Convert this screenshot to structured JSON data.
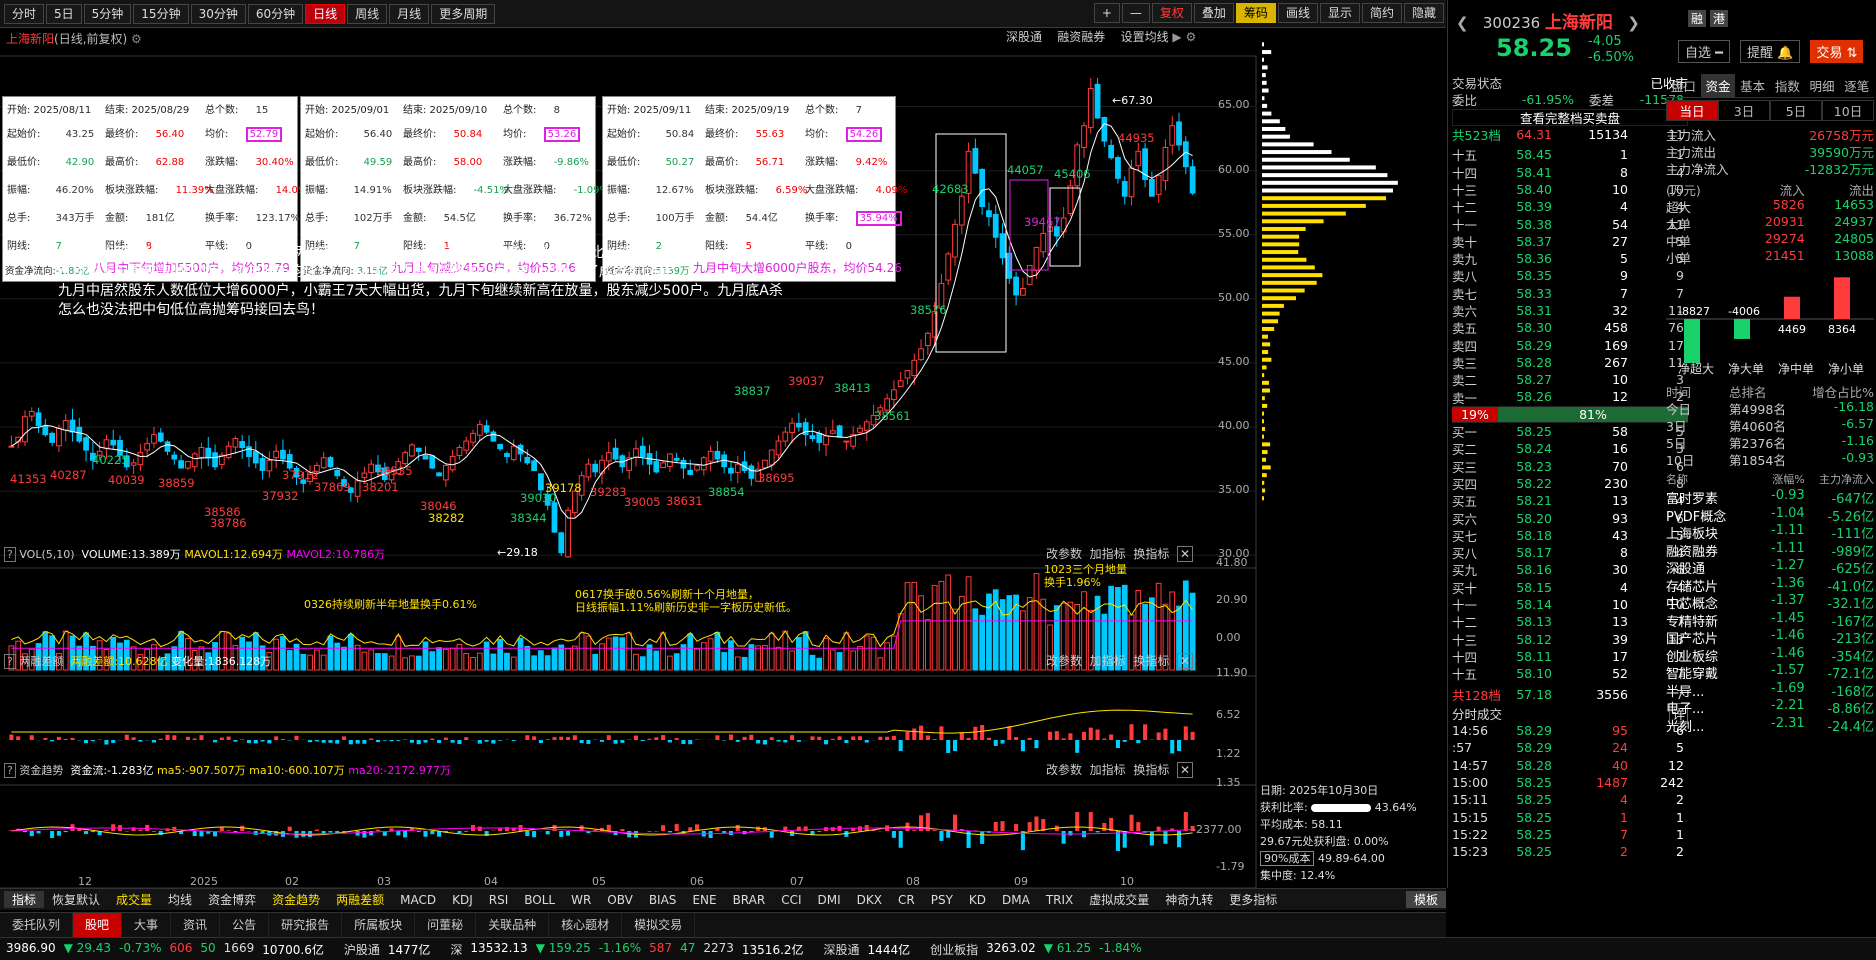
{
  "toolbar": {
    "periods": [
      "分时",
      "5日",
      "5分钟",
      "15分钟",
      "30分钟",
      "60分钟",
      "日线",
      "周线",
      "月线",
      "更多周期"
    ],
    "active": "日线",
    "right": [
      "+",
      "—",
      "复权",
      "叠加",
      "筹码",
      "画线",
      "显示",
      "简约",
      "隐藏"
    ]
  },
  "title": {
    "name": "上海新阳",
    "sub": "(日线,前复权)",
    "right": [
      "深股通",
      "融资融券",
      "设置均线"
    ]
  },
  "boxes": [
    {
      "start": "开始: 2025/08/11",
      "end": "结束: 2025/08/29",
      "count_label": "总个数:",
      "count": "15",
      "open_label": "起始价:",
      "open": "43.25",
      "close_label": "最终价:",
      "close": "56.40",
      "avg_label": "均价:",
      "avg": "52.79",
      "low_label": "最低价:",
      "low": "42.90",
      "high_label": "最高价:",
      "high": "62.88",
      "chg_label": "涨跌幅:",
      "chg": "30.40%",
      "amp_label": "振幅:",
      "amp": "46.20%",
      "sect_label": "板块涨跌幅:",
      "sect": "11.39%",
      "mkt_label": "大盘涨跌幅:",
      "mkt": "14.09%",
      "vol_label": "总手:",
      "vol": "343万手",
      "amt_label": "金额:",
      "amt": "181亿",
      "turn_label": "换手率:",
      "turn": "123.17%",
      "neg_label": "阴线:",
      "neg": "7",
      "pos_label": "阳线:",
      "pos": "8",
      "flat_label": "平线:",
      "flat": "0",
      "flow_label": "资金净流向:",
      "flow": "-1.80亿",
      "note": "八月中下旬增加5500户，均价52.79"
    },
    {
      "start": "开始: 2025/09/01",
      "end": "结束: 2025/09/10",
      "count_label": "总个数:",
      "count": "8",
      "open_label": "起始价:",
      "open": "56.40",
      "close_label": "最终价:",
      "close": "50.84",
      "avg_label": "均价:",
      "avg": "53.26",
      "low_label": "最低价:",
      "low": "49.59",
      "high_label": "最高价:",
      "high": "58.00",
      "chg_label": "涨跌幅:",
      "chg": "-9.86%",
      "amp_label": "振幅:",
      "amp": "14.91%",
      "sect_label": "板块涨跌幅:",
      "sect": "-4.51%",
      "mkt_label": "大盘涨跌幅:",
      "mkt": "-1.09%",
      "vol_label": "总手:",
      "vol": "102万手",
      "amt_label": "金额:",
      "amt": "54.5亿",
      "turn_label": "换手率:",
      "turn": "36.72%",
      "neg_label": "阴线:",
      "neg": "7",
      "pos_label": "阳线:",
      "pos": "1",
      "flat_label": "平线:",
      "flat": "0",
      "flow_label": "资金净流向:",
      "flow": "-3.15亿",
      "note": "九月上旬减少4550户，均价53.26"
    },
    {
      "start": "开始: 2025/09/11",
      "end": "结束: 2025/09/19",
      "count_label": "总个数:",
      "count": "7",
      "open_label": "起始价:",
      "open": "50.84",
      "close_label": "最终价:",
      "close": "55.63",
      "avg_label": "均价:",
      "avg": "54.26",
      "low_label": "最低价:",
      "low": "50.27",
      "high_label": "最高价:",
      "high": "56.71",
      "chg_label": "涨跌幅:",
      "chg": "9.42%",
      "amp_label": "振幅:",
      "amp": "12.67%",
      "sect_label": "板块涨跌幅:",
      "sect": "6.59%",
      "mkt_label": "大盘涨跌幅:",
      "mkt": "4.09%",
      "vol_label": "总手:",
      "vol": "100万手",
      "amt_label": "金额:",
      "amt": "54.4亿",
      "turn_label": "换手率:",
      "turn": "35.94%",
      "neg_label": "阴线:",
      "neg": "2",
      "pos_label": "阳线:",
      "pos": "5",
      "flat_label": "平线:",
      "flat": "0",
      "flow_label": "资金净流向:",
      "flow": "5139万",
      "note": "九月中旬大增6000户股东，均价54.26"
    }
  ],
  "comment": [
    "上海新阳四年A杀小霸王八月底九月底两次20+cmA杀，从股东人数看挖坑小霸王一次比一次惨！",
    "八月中下旬提前高抛增加5500户股东均价52.79，九月上旬A杀收割4550户，已经亏了成本和价差；",
    "九月中居然股东人数低位大增6000户，小霸王7天大幅出货，九月下旬继续新高在放量，股东减少500户。九月底A杀",
    "怎么也没法把中旬低位高抛筹码接回去鸟！"
  ],
  "price_axis": [
    "65.00",
    "60.00",
    "55.00",
    "50.00",
    "45.00",
    "40.00",
    "35.00",
    "30.00"
  ],
  "annotations": {
    "high": "67.30",
    "low": "29.18",
    "labels": [
      "41353",
      "40287",
      "40225",
      "40039",
      "38859",
      "38586",
      "38786",
      "37932",
      "37912",
      "37869",
      "38201",
      "38535",
      "38046",
      "38282",
      "38344",
      "39030",
      "39178",
      "39283",
      "39005",
      "38631",
      "38854",
      "38695",
      "38837",
      "39037",
      "38413",
      "38561",
      "38576",
      "42683",
      "44057",
      "39467",
      "45406",
      "44935"
    ]
  },
  "vol_pane": {
    "name": "VOL(5,10)",
    "volume": "VOLUME:13.389万",
    "ma1": "MAVOL1:12.694万",
    "ma2": "MAVOL2:10.786万",
    "axis": [
      "41.80",
      "20.90",
      "0.00"
    ],
    "note1": "0326持续刷新半年地量换手0.61%",
    "note2a": "0617换手破0.56%刷新十个月地量，",
    "note2b": "日线振幅1.11%刷新历史非一字板历史新低。",
    "note3a": "1023三个月地量",
    "note3b": "换手1.96%",
    "btns": [
      "改参数",
      "加指标",
      "换指标"
    ]
  },
  "margin_pane": {
    "name": "两融差额",
    "val": "两融差额:10.628亿",
    "chg": "变化量:1836.128万",
    "axis": [
      "11.90",
      "6.52",
      "1.22"
    ],
    "btns": [
      "改参数",
      "加指标",
      "换指标"
    ]
  },
  "flow_pane": {
    "name": "资金趋势",
    "val": "资金流:-1.283亿",
    "ma5": "ma5:-907.507万",
    "ma10": "ma10:-600.107万",
    "ma20": "ma20:-2172.977万",
    "axis": [
      "1.35",
      "-2377.00",
      "-1.79"
    ],
    "btns": [
      "改参数",
      "加指标",
      "换指标"
    ]
  },
  "xaxis": [
    "12",
    "2025",
    "02",
    "03",
    "04",
    "05",
    "06",
    "07",
    "08",
    "09",
    "10"
  ],
  "cost": {
    "date": "日期: 2025年10月30日",
    "ratio_label": "获利比率:",
    "ratio": "43.64%",
    "avg": "平均成本: 58.11",
    "line": "29.67元处获利盘: 0.00%",
    "range_label": "90%成本",
    "range": "49.89-64.00",
    "conc": "集中度: 12.4%"
  },
  "indicators": [
    "指标",
    "恢复默认",
    "成交量",
    "均线",
    "资金博弈",
    "资金趋势",
    "两融差额",
    "MACD",
    "KDJ",
    "RSI",
    "BOLL",
    "WR",
    "OBV",
    "BIAS",
    "ENE",
    "BRAR",
    "CCI",
    "DMI",
    "DKX",
    "CR",
    "PSY",
    "KD",
    "DMA",
    "TRIX",
    "虚拟成交量",
    "神奇九转",
    "更多指标",
    "模板"
  ],
  "tabs": [
    "委托队列",
    "股吧",
    "大事",
    "资讯",
    "公告",
    "研究报告",
    "所属板块",
    "问董秘",
    "关联品种",
    "核心题材",
    "模拟交易"
  ],
  "tabs_active": "股吧",
  "stock": {
    "code": "300236",
    "name": "上海新阳",
    "price": "58.25",
    "chg": "-4.05",
    "pct": "-6.50%",
    "btn1": "自选",
    "btn2": "提醒",
    "btn3": "交易",
    "tag1": "融",
    "tag2": "港"
  },
  "status": {
    "label": "交易状态",
    "value": "已收市",
    "wb_label": "委比",
    "wb": "-61.95%",
    "wc_label": "委差",
    "wc": "-11578",
    "full_btn": "查看完整档买卖盘",
    "total_label": "共523档",
    "total_price": "64.31",
    "total_vol": "15134",
    "total_cnt": "11",
    "buy_total_label": "共128档",
    "buy_total_price": "57.18",
    "buy_total_vol": "3556",
    "buy_total_cnt": "7",
    "ratio_left": "19%",
    "ratio_right": "81%"
  },
  "asks": [
    [
      "十五",
      "58.45",
      "1",
      "1"
    ],
    [
      "十四",
      "58.41",
      "8",
      "4"
    ],
    [
      "十三",
      "58.40",
      "10",
      "10"
    ],
    [
      "十二",
      "58.39",
      "4",
      "4"
    ],
    [
      "十一",
      "58.38",
      "54",
      "11"
    ],
    [
      "卖十",
      "58.37",
      "27",
      "5"
    ],
    [
      "卖九",
      "58.36",
      "5",
      "5"
    ],
    [
      "卖八",
      "58.35",
      "9",
      "9"
    ],
    [
      "卖七",
      "58.33",
      "7",
      "7"
    ],
    [
      "卖六",
      "58.31",
      "32",
      "11"
    ],
    [
      "卖五",
      "58.30",
      "458",
      "76"
    ],
    [
      "卖四",
      "58.29",
      "169",
      "17"
    ],
    [
      "卖三",
      "58.28",
      "267",
      "11"
    ],
    [
      "卖二",
      "58.27",
      "10",
      "3"
    ],
    [
      "卖一",
      "58.26",
      "12",
      "2"
    ]
  ],
  "bids": [
    [
      "买一",
      "58.25",
      "58",
      "5"
    ],
    [
      "买二",
      "58.24",
      "16",
      "3"
    ],
    [
      "买三",
      "58.23",
      "70",
      "6"
    ],
    [
      "买四",
      "58.22",
      "230",
      "8"
    ],
    [
      "买五",
      "58.21",
      "13",
      "4"
    ],
    [
      "买六",
      "58.20",
      "93",
      "6"
    ],
    [
      "买七",
      "58.18",
      "43",
      "5"
    ],
    [
      "买八",
      "58.17",
      "8",
      "4"
    ],
    [
      "买九",
      "58.16",
      "30",
      "6"
    ],
    [
      "买十",
      "58.15",
      "4",
      "4"
    ],
    [
      "十一",
      "58.14",
      "10",
      "10"
    ],
    [
      "十二",
      "58.13",
      "13",
      "7"
    ],
    [
      "十三",
      "58.12",
      "39",
      "13"
    ],
    [
      "十四",
      "58.11",
      "17",
      "7"
    ],
    [
      "十五",
      "58.10",
      "52",
      "7"
    ]
  ],
  "trades_title": "分时成交",
  "trades_btn": "详",
  "trades": [
    [
      "14:56",
      "58.29",
      "95",
      "6"
    ],
    [
      ":57",
      "58.29",
      "24",
      "5"
    ],
    [
      "14:57",
      "58.28",
      "40",
      "12"
    ],
    [
      "15:00",
      "58.25",
      "1487",
      "242"
    ],
    [
      "15:11",
      "58.25",
      "4",
      "2"
    ],
    [
      "15:15",
      "58.25",
      "1",
      "1"
    ],
    [
      "15:22",
      "58.25",
      "7",
      "1"
    ],
    [
      "15:23",
      "58.25",
      "2",
      "2"
    ]
  ],
  "fund_tabs": [
    "盘口",
    "资金",
    "基本",
    "指数",
    "明细",
    "逐笔"
  ],
  "fund_period": [
    "当日",
    "3日",
    "5日",
    "10日"
  ],
  "fund_flow": [
    [
      "主力流入",
      "26758万元"
    ],
    [
      "主力流出",
      "39590万元"
    ],
    [
      "主力净流入",
      "-12832万元"
    ]
  ],
  "fund_head": [
    "(万元)",
    "流入",
    "流出"
  ],
  "fund_rows": [
    [
      "超大",
      "5826",
      "14653"
    ],
    [
      "大单",
      "20931",
      "24937"
    ],
    [
      "中单",
      "29274",
      "24805"
    ],
    [
      "小单",
      "21451",
      "13088"
    ]
  ],
  "net_bars": {
    "labels": [
      "净超大",
      "净大单",
      "净中单",
      "净小单"
    ],
    "values": [
      -8827,
      -4006,
      4469,
      8364
    ]
  },
  "rank_head": [
    "时间",
    "总排名",
    "增仓占比%"
  ],
  "rank": [
    [
      "今日",
      "第4998名",
      "-16.18"
    ],
    [
      "3日",
      "第4060名",
      "-6.57"
    ],
    [
      "5日",
      "第2376名",
      "-1.16"
    ],
    [
      "10日",
      "第1854名",
      "-0.93"
    ]
  ],
  "sector_head": [
    "名称",
    "涨幅%",
    "主力净流入"
  ],
  "sectors": [
    [
      "富时罗素",
      "-0.93",
      "-647亿"
    ],
    [
      "PVDF概念",
      "-1.04",
      "-5.26亿"
    ],
    [
      "上海板块",
      "-1.11",
      "-111亿"
    ],
    [
      "融资融券",
      "-1.11",
      "-989亿"
    ],
    [
      "深股通",
      "-1.27",
      "-625亿"
    ],
    [
      "存储芯片",
      "-1.36",
      "-41.0亿"
    ],
    [
      "中芯概念",
      "-1.37",
      "-32.1亿"
    ],
    [
      "专精特新",
      "-1.45",
      "-167亿"
    ],
    [
      "国产芯片",
      "-1.46",
      "-213亿"
    ],
    [
      "创业板综",
      "-1.46",
      "-354亿"
    ],
    [
      "智能穿戴",
      "-1.57",
      "-72.1亿"
    ],
    [
      "半导...",
      "-1.69",
      "-168亿"
    ],
    [
      "电子...",
      "-2.21",
      "-8.86亿"
    ],
    [
      "光刻...",
      "-2.31",
      "-24.4亿"
    ]
  ],
  "ticker": [
    {
      "a": "3986.90",
      "b": "▼ 29.43",
      "c": "-0.73%",
      "d": "606",
      "e": "50",
      "f": "1669",
      "g": "10700.6亿"
    },
    {
      "name": "沪股通",
      "v": "1477亿"
    },
    {
      "name": "深",
      "a": "13532.13",
      "b": "▼ 159.25",
      "c": "-1.16%",
      "d": "587",
      "e": "47",
      "f": "2273",
      "g": "13516.2亿"
    },
    {
      "name": "深股通",
      "v": "1444亿"
    },
    {
      "name": "创业板指",
      "a": "3263.02",
      "b": "▼ 61.25",
      "c": "-1.84%"
    }
  ],
  "chart_data": {
    "type": "candlestick",
    "title": "上海新阳(日线,前复权)",
    "ylim": [
      29,
      68
    ],
    "xlabels": [
      "12",
      "2025",
      "02",
      "03",
      "04",
      "05",
      "06",
      "07",
      "08",
      "09",
      "10"
    ],
    "closes": [
      38.5,
      39.2,
      40.8,
      41.2,
      40.1,
      39.4,
      38.8,
      39.9,
      40.5,
      39.6,
      38.9,
      38.2,
      37.4,
      38.1,
      39.0,
      38.6,
      37.8,
      36.9,
      37.2,
      38.0,
      38.7,
      39.4,
      38.9,
      38.1,
      37.5,
      36.8,
      37.3,
      37.9,
      38.4,
      37.6,
      36.9,
      37.8,
      38.5,
      39.1,
      38.4,
      37.7,
      37.2,
      36.6,
      37.4,
      38.1,
      37.5,
      36.8,
      36.1,
      35.6,
      36.3,
      37.0,
      37.6,
      36.9,
      36.2,
      35.4,
      34.9,
      35.8,
      36.4,
      37.1,
      36.5,
      35.9,
      36.6,
      37.3,
      38.0,
      38.6,
      38.1,
      37.5,
      36.8,
      36.2,
      37.0,
      37.7,
      38.4,
      38.9,
      39.5,
      40.2,
      39.6,
      38.9,
      38.3,
      37.7,
      38.5,
      37.9,
      37.2,
      36.6,
      35.1,
      33.9,
      31.8,
      30.2,
      33.5,
      35.0,
      36.2,
      37.1,
      36.5,
      37.4,
      38.0,
      37.5,
      36.9,
      37.6,
      38.3,
      37.7,
      37.1,
      36.5,
      37.2,
      37.9,
      37.4,
      36.8,
      36.3,
      37.0,
      37.6,
      38.1,
      37.5,
      36.9,
      36.4,
      37.1,
      36.6,
      36.0,
      36.7,
      37.4,
      38.2,
      38.9,
      39.6,
      40.3,
      40.0,
      39.4,
      39.1,
      38.8,
      39.3,
      39.7,
      39.2,
      38.9,
      39.4,
      39.9,
      40.4,
      40.9,
      41.5,
      42.2,
      42.9,
      43.6,
      44.4,
      45.2,
      46.1,
      47.3,
      49.0,
      51.2,
      53.5,
      55.8,
      58.0,
      61.5,
      59.8,
      57.2,
      56.4,
      54.8,
      53.2,
      51.6,
      50.3,
      50.8,
      52.6,
      54.0,
      55.1,
      55.6,
      54.9,
      56.3,
      58.8,
      62.0,
      63.5,
      66.4,
      64.1,
      62.3,
      61.0,
      59.4,
      58.0,
      60.2,
      61.5,
      59.3,
      58.0,
      59.6,
      61.8,
      63.5,
      62.0,
      60.3,
      58.25
    ]
  }
}
